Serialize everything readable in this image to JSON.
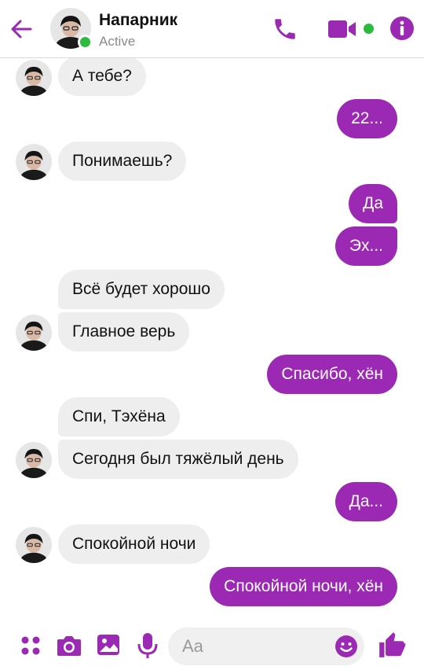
{
  "header": {
    "contact_name": "Напарник",
    "status": "Active"
  },
  "messages": [
    {
      "side": "in",
      "text": "А тебе?"
    },
    {
      "side": "out",
      "text": "22..."
    },
    {
      "side": "in",
      "text": "Понимаешь?"
    },
    {
      "side": "out",
      "text": "Да"
    },
    {
      "side": "out",
      "text": "Эх..."
    },
    {
      "side": "in",
      "text": "Всё будет хорошо"
    },
    {
      "side": "in",
      "text": "Главное верь"
    },
    {
      "side": "out",
      "text": "Спасибо, хён"
    },
    {
      "side": "in",
      "text": "Спи, Тэхёна"
    },
    {
      "side": "in",
      "text": "Сегодня был тяжёлый день"
    },
    {
      "side": "out",
      "text": "Да..."
    },
    {
      "side": "in",
      "text": "Спокойной ночи"
    },
    {
      "side": "out",
      "text": "Спокойной ночи, хён"
    }
  ],
  "composer": {
    "placeholder": "Aa"
  },
  "colors": {
    "accent": "#9c29b3",
    "online": "#2dbb3e",
    "incoming_bubble": "#eeeeee"
  },
  "icons": [
    "back-arrow-icon",
    "phone-icon",
    "video-camera-icon",
    "info-icon",
    "apps-icon",
    "camera-icon",
    "image-icon",
    "microphone-icon",
    "emoji-icon",
    "thumbs-up-icon"
  ]
}
